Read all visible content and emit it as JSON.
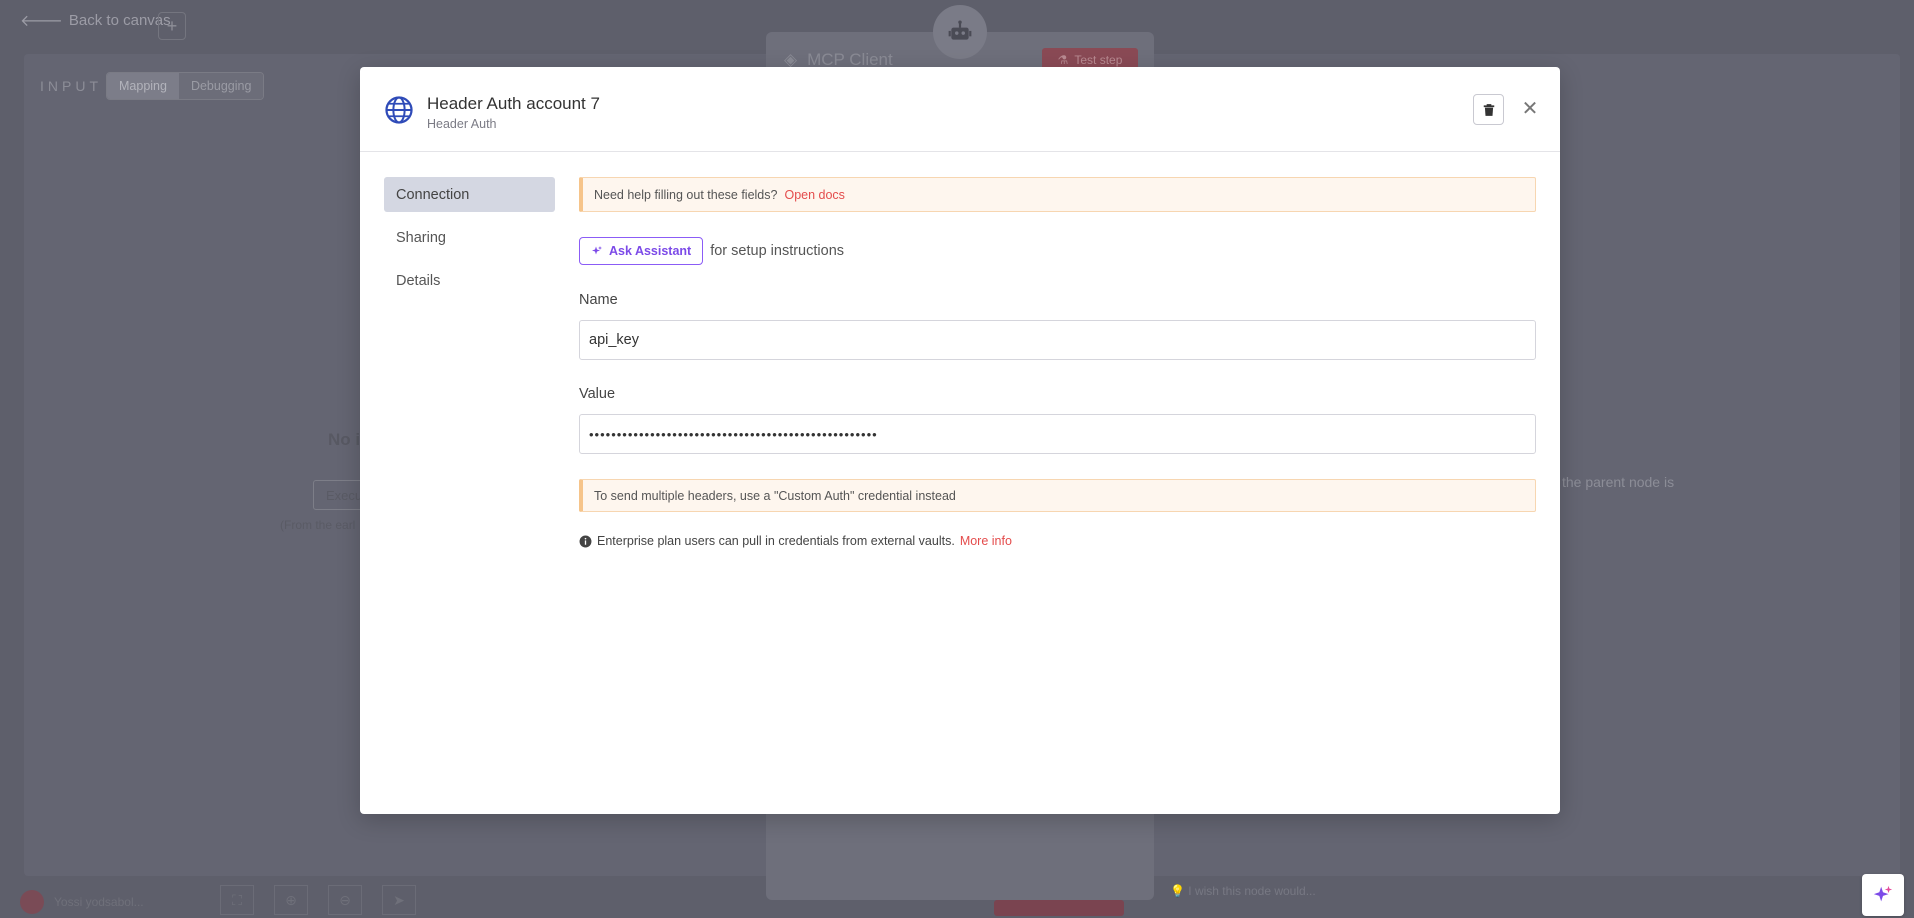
{
  "background": {
    "back_label": "Back to canvas",
    "plus_label": "+",
    "input_label": "INPUT",
    "tabs": [
      "Mapping",
      "Debugging"
    ],
    "node_title": "MCP Client",
    "test_step": "Test step",
    "no_input_fragment": "No i",
    "execute_fragment": "Execu",
    "from_fragment": "(From the earl",
    "parent_fragment": "the parent node is",
    "user_name": "Yossi yodsabol...",
    "wish_text": "I wish this node would..."
  },
  "modal": {
    "title": "Header Auth account 7",
    "subtitle": "Header Auth",
    "nav": [
      "Connection",
      "Sharing",
      "Details"
    ],
    "help_notice": "Need help filling out these fields?",
    "help_link": "Open docs",
    "assistant_button": "Ask Assistant",
    "assistant_text": "for setup instructions",
    "name_label": "Name",
    "name_value": "api_key",
    "value_label": "Value",
    "value_masked": "••••••••••••••••••••••••••••••••••••••••••••••••••••",
    "multi_header_notice": "To send multiple headers, use a \"Custom Auth\" credential instead",
    "enterprise_text": "Enterprise plan users can pull in credentials from external vaults.",
    "enterprise_link": "More info"
  },
  "colors": {
    "accent": "#e44c4c",
    "assistant": "#7c4ae8",
    "nav_active": "#d4d7e2",
    "notice_bg": "#fef6ee"
  }
}
